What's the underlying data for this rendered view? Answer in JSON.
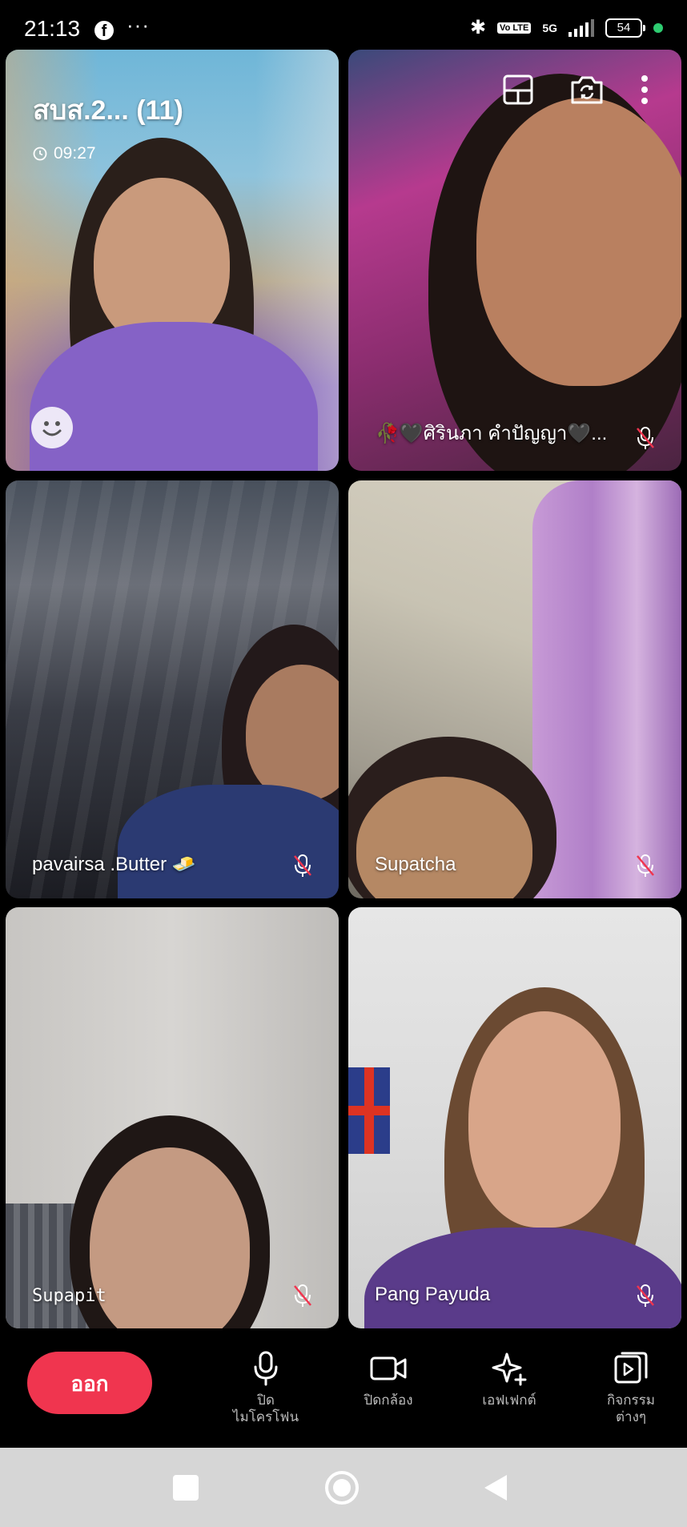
{
  "status_bar": {
    "time": "21:13",
    "battery": "54",
    "network": "5G",
    "volte": "Vo LTE"
  },
  "call": {
    "title": "สบส.2... (11)",
    "duration": "09:27"
  },
  "participants": [
    {
      "name": ""
    },
    {
      "name": "🥀🖤ศิรินภา คำปัญญา🖤...",
      "muted": true
    },
    {
      "name": "pavairsa .Butter 🧈",
      "muted": true
    },
    {
      "name": "Supatcha",
      "muted": true
    },
    {
      "name": "Supapit",
      "muted": true
    },
    {
      "name": "Pang Payuda",
      "muted": true
    }
  ],
  "controls": {
    "leave": "ออก",
    "mic": "ปิด\nไมโครโฟน",
    "camera": "ปิดกล้อง",
    "effects": "เอฟเฟกต์",
    "activities": "กิจกรรม\nต่างๆ"
  },
  "icons": [
    "facebook-icon",
    "bluetooth-icon",
    "signal-icon",
    "battery-icon",
    "clock-icon",
    "layout-icon",
    "switch-camera-icon",
    "more-options-icon",
    "emoji-icon",
    "mic-off-icon",
    "mic-icon",
    "video-icon",
    "sparkle-icon",
    "activities-icon",
    "nav-recents-icon",
    "nav-home-icon",
    "nav-back-icon"
  ],
  "colors": {
    "leave_button": "#f0354f",
    "nav_bar": "#d6d6d6",
    "status_dot": "#2ecc71"
  }
}
